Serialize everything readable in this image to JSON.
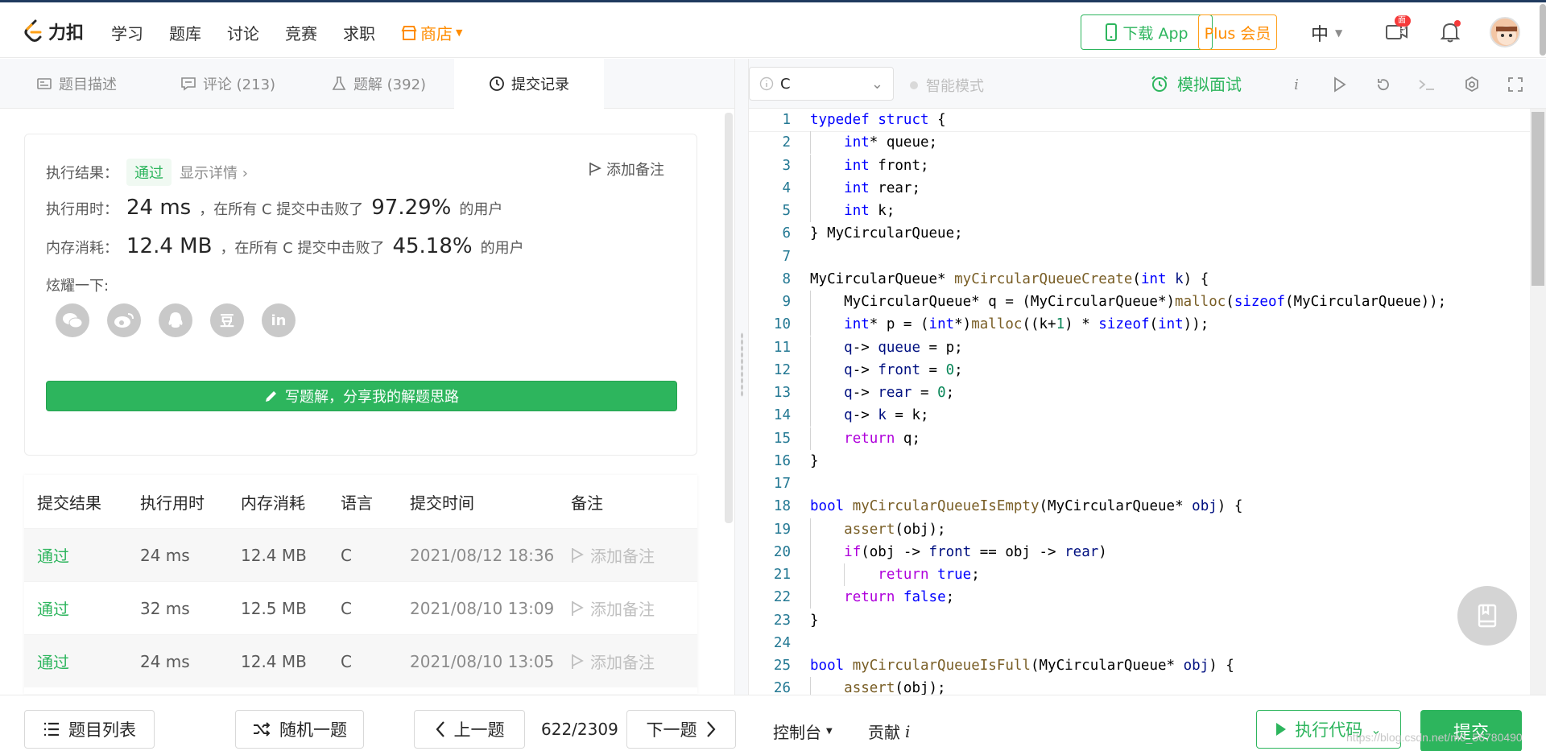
{
  "nav": {
    "brand": "力扣",
    "items": [
      "学习",
      "题库",
      "讨论",
      "竞赛",
      "求职"
    ],
    "shop": "商店",
    "download_app": "下载 App",
    "plus": "Plus 会员",
    "lang": "中",
    "interview_badge": "面试"
  },
  "left_tabs": [
    {
      "label": "题目描述",
      "icon": "description-icon"
    },
    {
      "label": "评论 (213)",
      "icon": "comment-icon"
    },
    {
      "label": "题解 (392)",
      "icon": "flask-icon"
    },
    {
      "label": "提交记录",
      "icon": "clock-icon"
    }
  ],
  "result": {
    "label_result": "执行结果：",
    "status": "通过",
    "details": "显示详情",
    "add_note": "添加备注",
    "label_time": "执行用时：",
    "time_value": "24 ms",
    "time_mid": "，在所有 C 提交中击败了",
    "time_pct": "97.29%",
    "suffix": "的用户",
    "label_mem": "内存消耗：",
    "mem_value": "12.4 MB",
    "mem_mid": "，在所有 C 提交中击败了",
    "mem_pct": "45.18%",
    "share_label": "炫耀一下:",
    "share_icons": [
      "wechat-icon",
      "weibo-icon",
      "qq-icon",
      "douban-icon",
      "linkedin-icon"
    ],
    "douban_text": "豆",
    "linkedin_text": "in",
    "write_btn": "写题解，分享我的解题思路"
  },
  "submissions": {
    "headers": [
      "提交结果",
      "执行用时",
      "内存消耗",
      "语言",
      "提交时间",
      "备注"
    ],
    "rows": [
      {
        "result": "通过",
        "time": "24 ms",
        "mem": "12.4 MB",
        "lang": "C",
        "date": "2021/08/12 18:36",
        "note": "添加备注"
      },
      {
        "result": "通过",
        "time": "32 ms",
        "mem": "12.5 MB",
        "lang": "C",
        "date": "2021/08/10 13:09",
        "note": "添加备注"
      },
      {
        "result": "通过",
        "time": "24 ms",
        "mem": "12.4 MB",
        "lang": "C",
        "date": "2021/08/10 13:05",
        "note": "添加备注"
      }
    ]
  },
  "editor_toolbar": {
    "language": "C",
    "smart_mode": "智能模式",
    "mock_interview": "模拟面试"
  },
  "code": {
    "line_numbers": [
      "1",
      "2",
      "3",
      "4",
      "5",
      "6",
      "7",
      "8",
      "9",
      "10",
      "11",
      "12",
      "13",
      "14",
      "15",
      "16",
      "17",
      "18",
      "19",
      "20",
      "21",
      "22",
      "23",
      "24",
      "25",
      "26"
    ]
  },
  "bottom": {
    "problem_list": "题目列表",
    "random": "随机一题",
    "prev": "上一题",
    "progress": "622/2309",
    "next": "下一题",
    "console": "控制台",
    "contribute": "贡献",
    "run": "执行代码",
    "submit": "提交",
    "watermark": "https://blog.csdn.net/m0_56780490"
  },
  "colors": {
    "accent_green": "#2db55d",
    "orange": "#ff8c00",
    "keyword_blue": "#0000ff",
    "control_purple": "#af00db",
    "function_brown": "#795e26",
    "line_number": "#237893"
  }
}
